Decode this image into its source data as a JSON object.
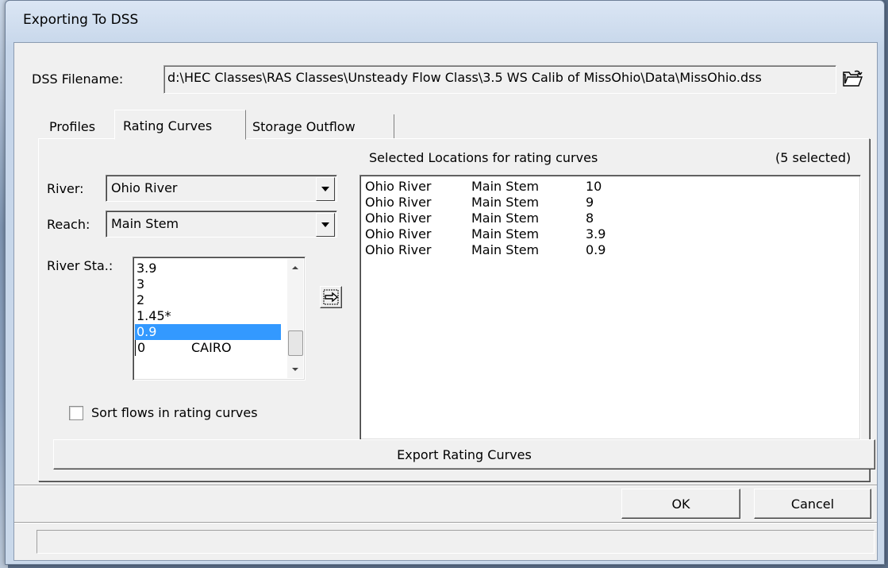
{
  "window": {
    "title": "Exporting To DSS"
  },
  "dss": {
    "label": "DSS Filename:",
    "value": "d:\\HEC Classes\\RAS Classes\\Unsteady Flow Class\\3.5 WS Calib of MissOhio\\Data\\MissOhio.dss",
    "browse_icon": "open-folder-icon"
  },
  "tabs": [
    {
      "label": "Profiles",
      "active": false
    },
    {
      "label": "Rating Curves",
      "active": true
    },
    {
      "label": "Storage Outflow",
      "active": false
    }
  ],
  "selection": {
    "river_label": "River:",
    "river_value": "Ohio River",
    "reach_label": "Reach:",
    "reach_value": "Main Stem",
    "station_label": "River Sta.:",
    "stations": [
      {
        "sta": "3.9",
        "name": ""
      },
      {
        "sta": "3",
        "name": ""
      },
      {
        "sta": "2",
        "name": ""
      },
      {
        "sta": "1.45*",
        "name": ""
      },
      {
        "sta": "0.9",
        "name": "",
        "selected": true
      },
      {
        "sta": "0",
        "name": "CAIRO"
      }
    ],
    "add_icon": "add-arrow-icon"
  },
  "selected": {
    "header": "Selected Locations for rating curves",
    "count": "(5 selected)",
    "rows": [
      {
        "river": "Ohio River",
        "reach": "Main Stem",
        "sta": "10"
      },
      {
        "river": "Ohio River",
        "reach": "Main Stem",
        "sta": "9"
      },
      {
        "river": "Ohio River",
        "reach": "Main Stem",
        "sta": "8"
      },
      {
        "river": "Ohio River",
        "reach": "Main Stem",
        "sta": "3.9"
      },
      {
        "river": "Ohio River",
        "reach": "Main Stem",
        "sta": "0.9"
      }
    ]
  },
  "options": {
    "sort_label": "Sort flows in rating curves",
    "sort_checked": false
  },
  "buttons": {
    "export": "Export Rating Curves",
    "ok": "OK",
    "cancel": "Cancel"
  },
  "status": {
    "text": ""
  }
}
